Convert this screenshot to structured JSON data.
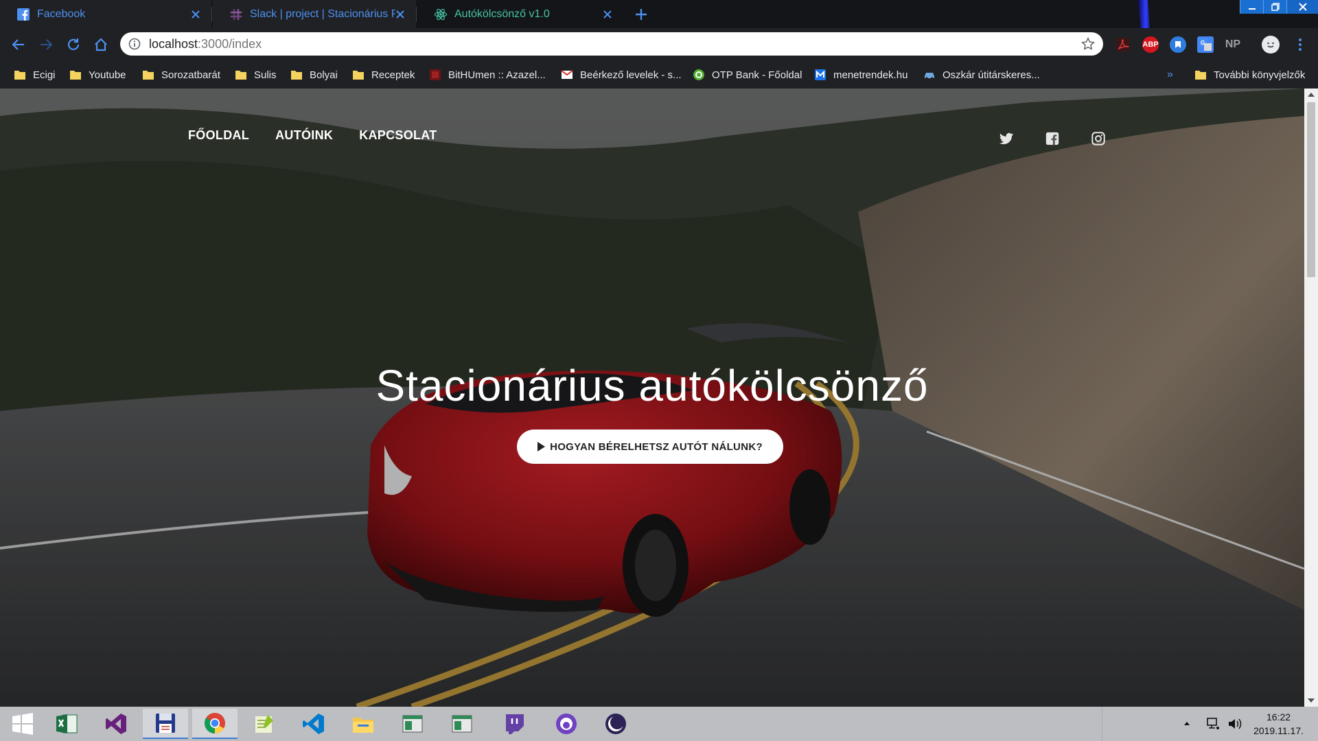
{
  "browser": {
    "tabs": [
      {
        "title": "Facebook",
        "icon": "facebook-icon",
        "color": "#4c91f0"
      },
      {
        "title": "Slack | project | Stacionárius Pont",
        "icon": "slack-icon",
        "color": "#4c91f0"
      },
      {
        "title": "Autókölcsönző v1.0",
        "icon": "react-icon",
        "color": "#45c3a5",
        "active": true
      }
    ],
    "address": {
      "host": "localhost",
      "path": ":3000/index"
    },
    "extensions": [
      "pdf-icon",
      "adblock-plus-icon",
      "bookmark-extension-icon",
      "translate-icon",
      "np-extension-icon",
      "profile-avatar-icon",
      "menu-icon"
    ],
    "ext_labels": {
      "adblock": "ABP",
      "np": "NP"
    },
    "bookmarks": [
      {
        "label": "Ecigi",
        "icon": "folder-icon"
      },
      {
        "label": "Youtube",
        "icon": "folder-icon"
      },
      {
        "label": "Sorozatbarát",
        "icon": "folder-icon"
      },
      {
        "label": "Sulis",
        "icon": "folder-icon"
      },
      {
        "label": "Bolyai",
        "icon": "folder-icon"
      },
      {
        "label": "Receptek",
        "icon": "folder-icon"
      },
      {
        "label": "BitHUmen :: Azazel...",
        "icon": "bithumen-icon"
      },
      {
        "label": "Beérkező levelek - s...",
        "icon": "gmail-icon"
      },
      {
        "label": "OTP Bank - Főoldal",
        "icon": "otp-icon"
      },
      {
        "label": "menetrendek.hu",
        "icon": "menetrendek-icon"
      },
      {
        "label": "Oszkár útitárskeres...",
        "icon": "car-icon"
      }
    ],
    "bookmarks_overflow": "»",
    "other_bookmarks": "További könyvjelzők"
  },
  "site": {
    "nav": [
      "FŐOLDAL",
      "AUTÓINK",
      "KAPCSOLAT"
    ],
    "social": [
      "twitter-icon",
      "facebook-square-icon",
      "instagram-icon"
    ],
    "title": "Stacionárius autókölcsönző",
    "cta": "HOGYAN BÉRELHETSZ AUTÓT NÁLUNK?"
  },
  "taskbar": {
    "apps": [
      "windows-start-icon",
      "excel-icon",
      "visual-studio-icon",
      "save-disk-icon",
      "chrome-icon",
      "notepad-plus-plus-icon",
      "vscode-icon",
      "file-explorer-icon",
      "window-app-icon",
      "window-app-icon",
      "twitch-icon",
      "github-desktop-icon",
      "eclipse-icon"
    ],
    "time": "16:22",
    "date": "2019.11.17."
  },
  "colors": {
    "accent_blue": "#4c91f0",
    "active_tab_text": "#45c3a5",
    "tab_bg": "#202124",
    "page_car_red": "#a01418"
  }
}
